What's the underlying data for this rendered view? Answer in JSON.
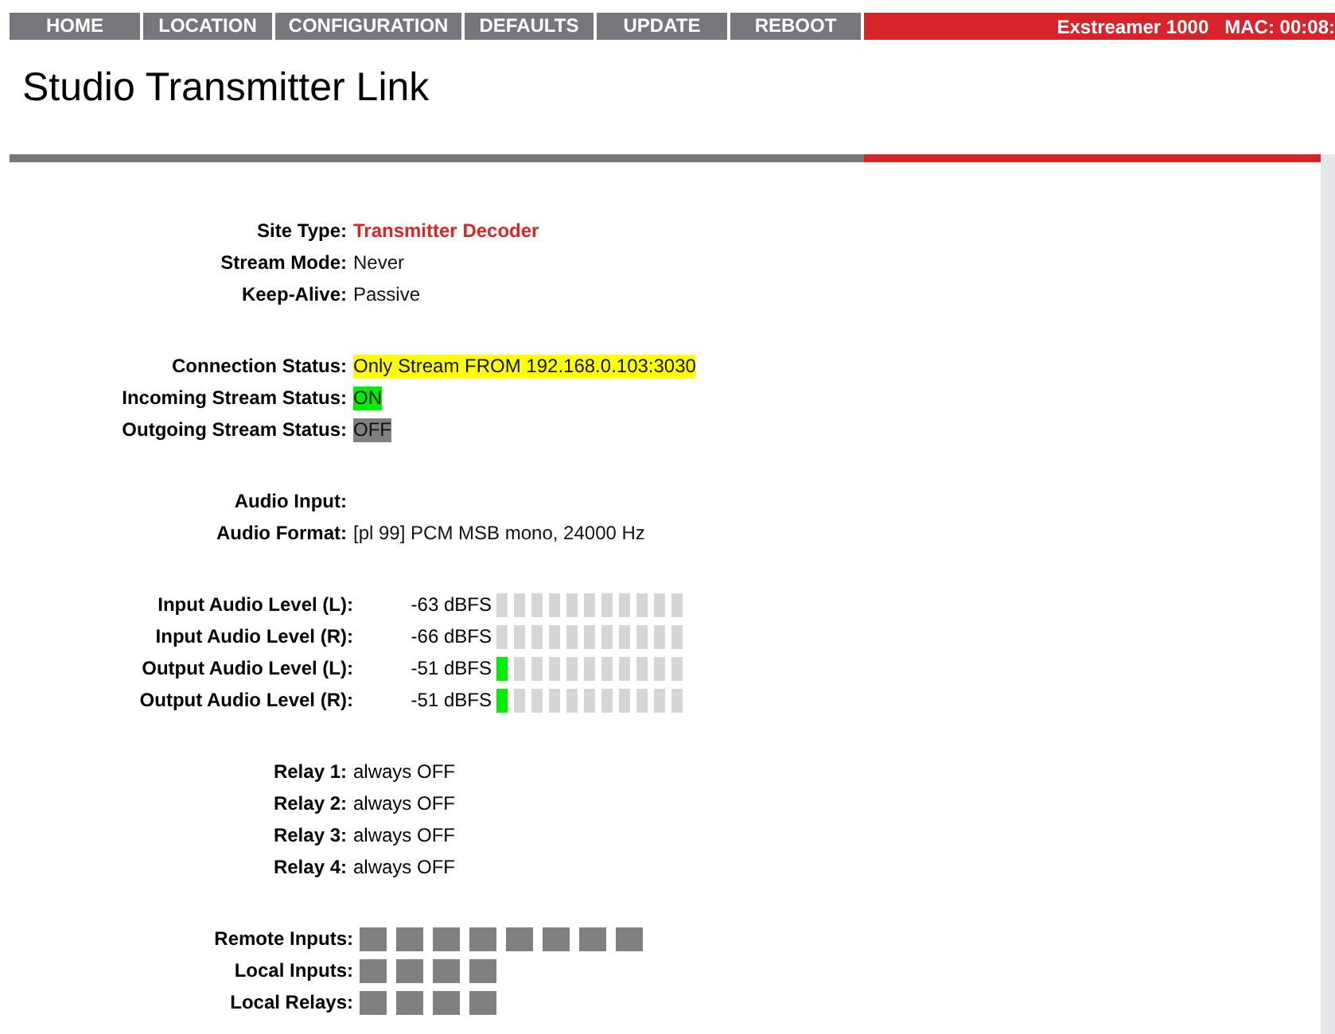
{
  "nav": {
    "tabs": [
      {
        "label": "HOME"
      },
      {
        "label": "LOCATION"
      },
      {
        "label": "CONFIGURATION"
      },
      {
        "label": "DEFAULTS"
      },
      {
        "label": "UPDATE"
      },
      {
        "label": "REBOOT"
      }
    ],
    "device": "Exstreamer 1000",
    "mac": "MAC: 00:08:"
  },
  "title": "Studio Transmitter Link",
  "sections": [
    {
      "rows": [
        {
          "label": "Site Type:",
          "value": "Transmitter Decoder",
          "kind": "alert"
        },
        {
          "label": "Stream Mode:",
          "value": "Never",
          "kind": "plain"
        },
        {
          "label": "Keep-Alive:",
          "value": "Passive",
          "kind": "plain"
        }
      ]
    },
    {
      "rows": [
        {
          "label": "Connection Status:",
          "value": "Only Stream FROM 192.168.0.103:3030",
          "kind": "warning"
        },
        {
          "label": "Incoming Stream Status:",
          "value": "ON",
          "kind": "on"
        },
        {
          "label": "Outgoing Stream Status:",
          "value": "OFF",
          "kind": "off"
        }
      ]
    },
    {
      "rows": [
        {
          "label": "Audio Input:"
        },
        {
          "label": "Audio Format:",
          "value": "[pl 99] PCM MSB mono, 24000 Hz",
          "kind": "plain"
        }
      ]
    }
  ],
  "meters": [
    {
      "label": "Input Audio Level (L):",
      "reading": "-63 dBFS",
      "level": 0
    },
    {
      "label": "Input Audio Level (R):",
      "reading": "-66 dBFS",
      "level": 0
    },
    {
      "label": "Output Audio Level (L):",
      "reading": "-51 dBFS",
      "level": 0.09
    },
    {
      "label": "Output Audio Level (R):",
      "reading": "-51 dBFS",
      "level": 0.09
    }
  ],
  "relays": [
    {
      "label": "Relay 1:",
      "value": "always OFF"
    },
    {
      "label": "Relay 2:",
      "value": "always OFF"
    },
    {
      "label": "Relay 3:",
      "value": "always OFF"
    },
    {
      "label": "Relay 4:",
      "value": "always OFF"
    }
  ],
  "indicators": [
    {
      "label": "Remote Inputs:",
      "lights": [
        {
          "on": false
        },
        {
          "on": false
        },
        {
          "on": false
        },
        {
          "on": false
        },
        {
          "on": false
        },
        {
          "on": false
        },
        {
          "on": false
        },
        {
          "on": false
        }
      ]
    },
    {
      "label": "Local Inputs:",
      "lights": [
        {
          "on": false
        },
        {
          "on": false
        },
        {
          "on": false
        },
        {
          "on": false
        }
      ]
    },
    {
      "label": "Local Relays:",
      "lights": [
        {
          "on": false
        },
        {
          "on": false
        },
        {
          "on": false
        },
        {
          "on": false
        }
      ]
    }
  ]
}
